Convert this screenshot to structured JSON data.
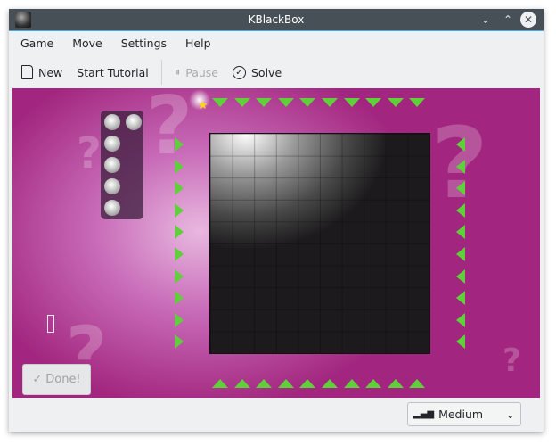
{
  "window": {
    "title": "KBlackBox"
  },
  "menu": [
    "Game",
    "Move",
    "Settings",
    "Help"
  ],
  "toolbar": {
    "new": "New",
    "tutorial": "Start Tutorial",
    "pause": "Pause",
    "solve": "Solve"
  },
  "game": {
    "balls_remaining": 6,
    "board_size": 10,
    "done": "Done!"
  },
  "status": {
    "difficulty": "Medium"
  },
  "colors": {
    "background": "#a2267f",
    "arrow": "#5fd03a",
    "titlebar": "#475057"
  }
}
